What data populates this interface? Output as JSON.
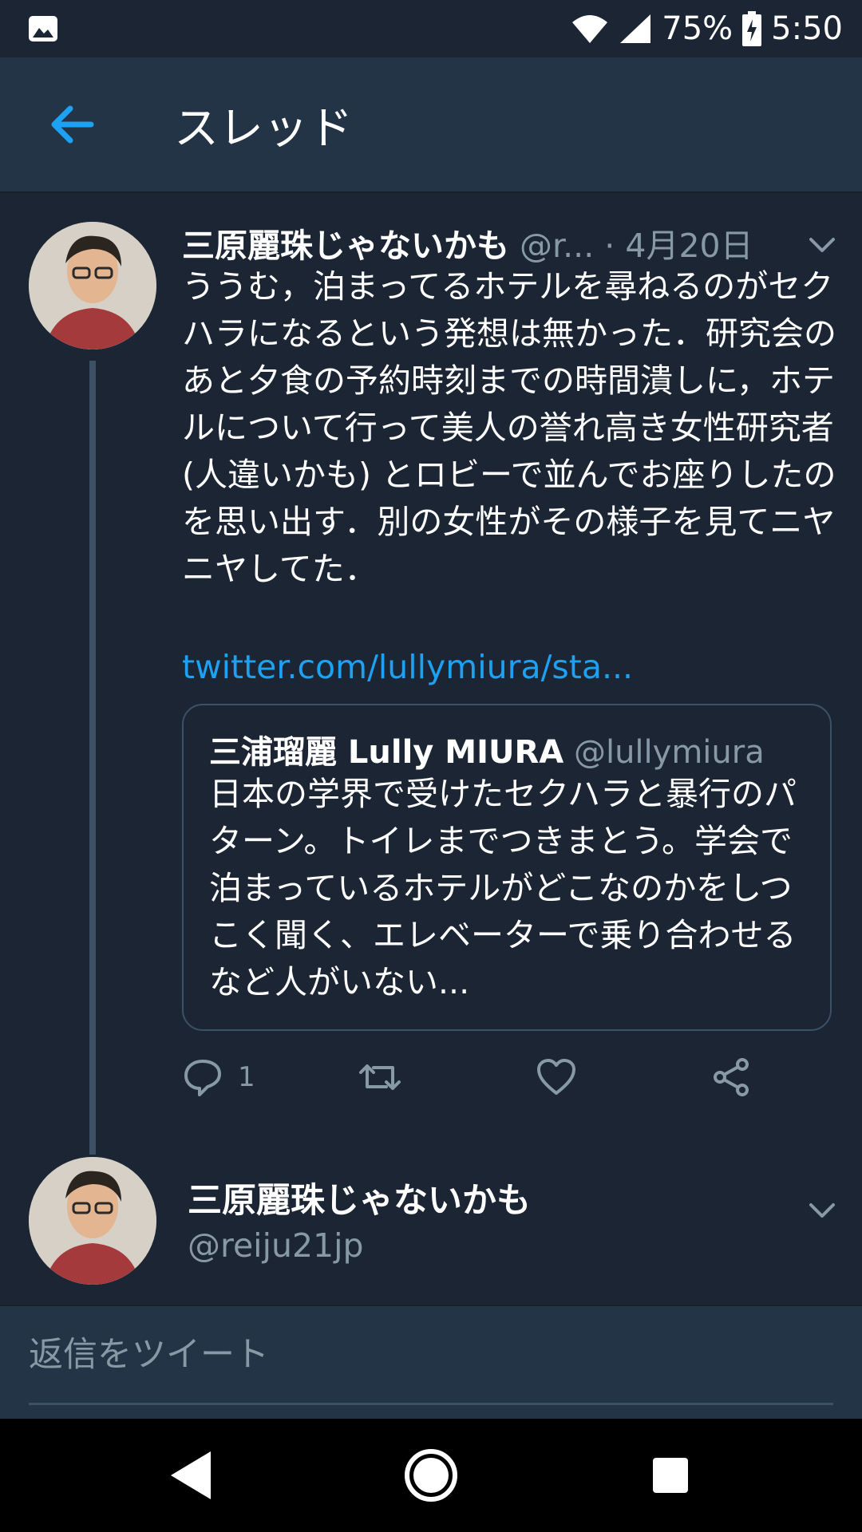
{
  "status_bar": {
    "battery": "75%",
    "time": "5:50",
    "icons": [
      "image-icon",
      "wifi-icon",
      "signal-icon",
      "battery-icon"
    ]
  },
  "app_bar": {
    "title": "スレッド",
    "back_icon": "back-arrow-icon"
  },
  "colors": {
    "background": "#1b2533",
    "bar": "#243447",
    "accent": "#1da1f2",
    "secondary_text": "#8899a6",
    "divider": "#3d5166"
  },
  "tweet1": {
    "name": "三原麗珠じゃないかも",
    "handle": "@r...",
    "date": "· 4月20日",
    "body": "ううむ，泊まってるホテルを尋ねるのがセクハラになるという発想は無かった．研究会のあと夕食の予約時刻までの時間潰しに，ホテルについて行って美人の誉れ高き女性研究者 (人違いかも) とロビーで並んでお座りしたのを思い出す．別の女性がその様子を見てニヤニヤしてた．",
    "link": "twitter.com/lullymiura/sta...",
    "quote": {
      "name": "三浦瑠麗 Lully MIURA",
      "handle": "@lullymiura",
      "body": "日本の学界で受けたセクハラと暴行のパターン。トイレまでつきまとう。学会で泊まっているホテルがどこなのかをしつこく聞く、エレベーターで乗り合わせるなど人がいない..."
    },
    "actions": {
      "reply_count": "1"
    }
  },
  "tweet2": {
    "name": "三原麗珠じゃないかも",
    "handle": "@reiju21jp"
  },
  "reply_bar": {
    "placeholder": "返信をツイート"
  }
}
